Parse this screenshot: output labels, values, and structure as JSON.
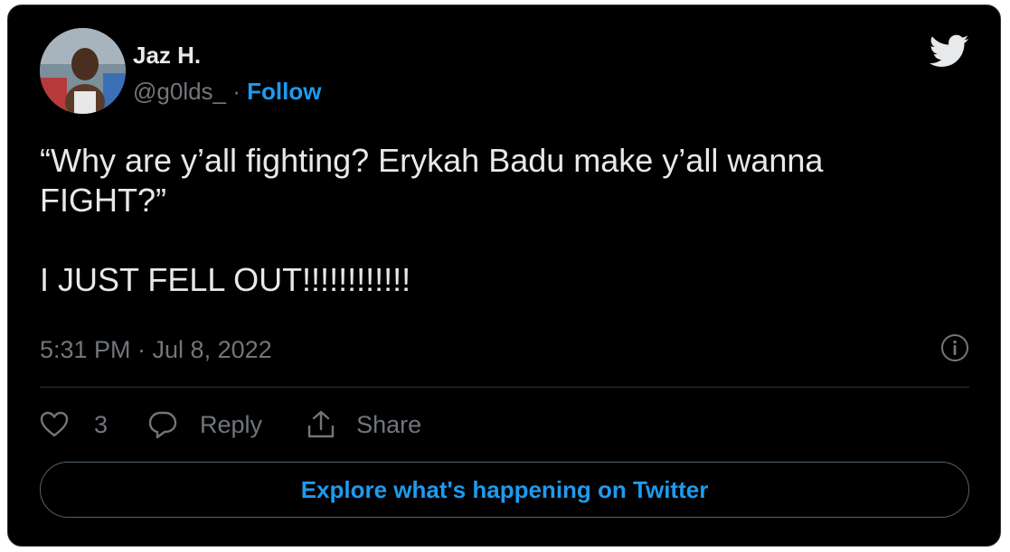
{
  "tweet": {
    "author_name": "Jaz H.",
    "author_handle": "@g0lds_",
    "separator": "·",
    "follow_label": "Follow",
    "text": "“Why are y’all fighting? Erykah Badu make y’all wanna FIGHT?”\n\nI JUST FELL OUT!!!!!!!!!!!!",
    "timestamp": "5:31 PM · Jul 8, 2022",
    "like_count": "3",
    "reply_label": "Reply",
    "share_label": "Share",
    "explore_label": "Explore what's happening on Twitter"
  },
  "icons": {
    "brand": "twitter-bird-icon",
    "info": "info-icon",
    "like": "heart-icon",
    "reply": "reply-bubble-icon",
    "share": "share-icon"
  },
  "colors": {
    "background": "#000000",
    "text": "#e7e9ea",
    "muted": "#71767b",
    "accent": "#1d9bf0",
    "border": "#2f3336"
  }
}
